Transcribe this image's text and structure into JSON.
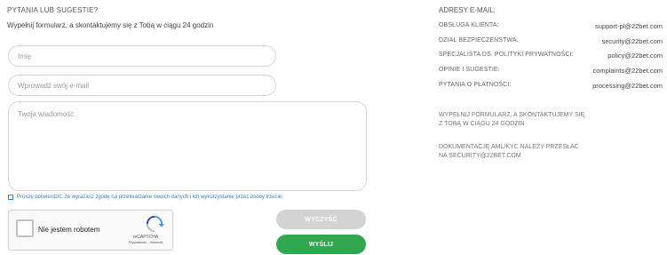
{
  "form": {
    "title": "PYTANIA LUB SUGESTIE?",
    "subtitle": "Wypełnij formularz, a skontaktujemy się z Tobą w ciągu 24 godzin",
    "name_placeholder": "Imię",
    "email_placeholder": "Wprowadź swój e-mail",
    "message_placeholder": "Twoja wiadomość",
    "consent_text": "Proszę potwierdzić, że wyrażasz zgodę na przetwarzanie swoich danych i ich wykorzystanie przez osoby trzecie.",
    "clear_label": "WYCZYŚĆ",
    "send_label": "WYŚLIJ"
  },
  "recaptcha": {
    "label": "Nie jestem robotem",
    "brand": "reCAPTCHA",
    "links": "Prywatność - Warunki"
  },
  "contacts": {
    "title": "ADRESY E-MAIL:",
    "rows": [
      {
        "label": "OBSŁUGA KLIENTA:",
        "email": "support-pl@22bet.com"
      },
      {
        "label": "DZIAŁ BEZPIECZEŃSTWA:",
        "email": "security@22bet.com"
      },
      {
        "label": "SPECJALISTA DS. POLITYKI PRYWATNOŚCI:",
        "email": "policy@22bet.com"
      },
      {
        "label": "OPINIE I SUGESTIE:",
        "email": "complaints@22bet.com"
      },
      {
        "label": "PYTANIA O PŁATNOŚCI:",
        "email": "processing@22bet.com"
      }
    ],
    "note1_line1": "WYPEŁNIJ FORMULARZ, A SKONTAKTUJEMY SIĘ",
    "note1_line2": "Z TOBĄ W CIĄGU 24 GODZIN",
    "note2_line1": "DOKUMENTACJĘ AML/KYC NALEŻY PRZESŁAĆ",
    "note2_line2": "NA SECURITY@22BET.COM"
  },
  "colors": {
    "send_button": "#2fa850",
    "clear_button": "#d3d3d3",
    "consent_link": "#3d7db8"
  }
}
